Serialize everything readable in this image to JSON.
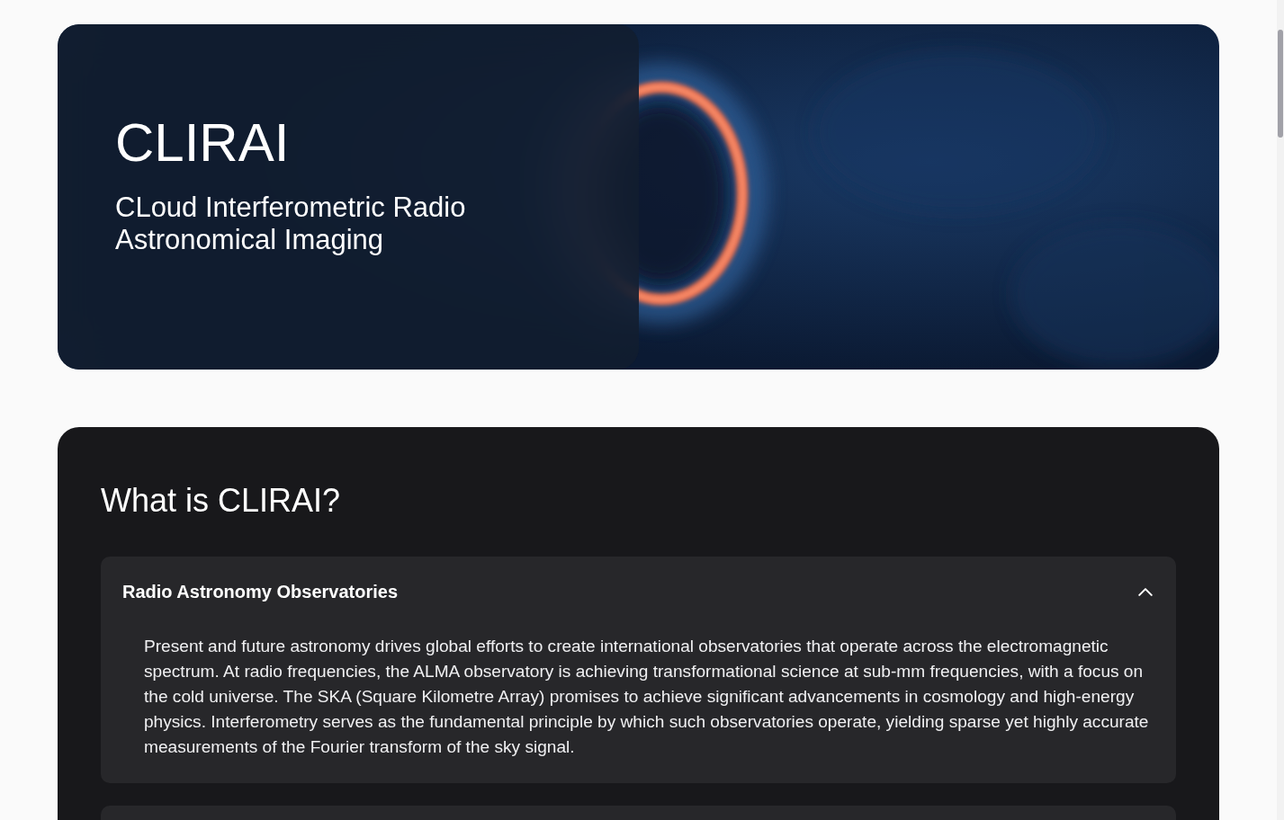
{
  "hero": {
    "title": "CLIRAI",
    "subtitle": "CLoud Interferometric Radio Astronomical Imaging"
  },
  "section": {
    "heading": "What is CLIRAI?",
    "items": [
      {
        "title": "Radio Astronomy Observatories",
        "expanded": true,
        "body": "Present and future astronomy drives global efforts to create international observatories that operate across the electromagnetic spectrum. At radio frequencies, the ALMA observatory is achieving transformational science at sub-mm frequencies, with a focus on the cold universe. The SKA (Square Kilometre Array) promises to achieve significant advancements in cosmology and high-energy physics. Interferometry serves as the fundamental principle by which such observatories operate, yielding sparse yet highly accurate measurements of the Fourier transform of the sky signal."
      }
    ]
  }
}
